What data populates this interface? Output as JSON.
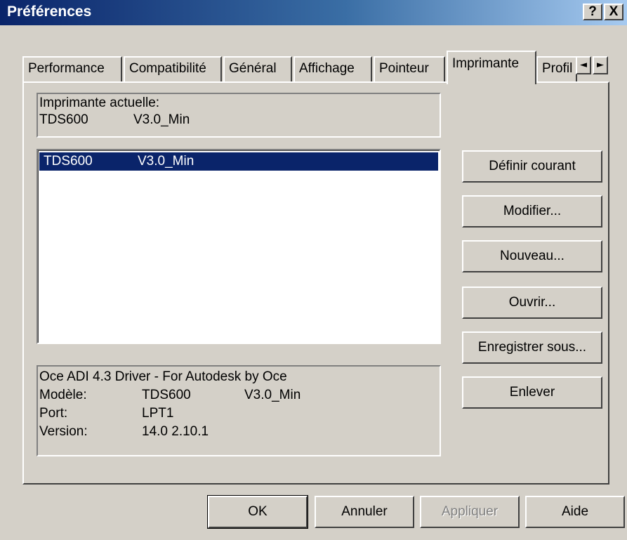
{
  "window": {
    "title": "Préférences",
    "help_symbol": "?",
    "close_symbol": "X"
  },
  "tabs": [
    {
      "label": "Performance"
    },
    {
      "label": "Compatibilité"
    },
    {
      "label": "Général"
    },
    {
      "label": "Affichage"
    },
    {
      "label": "Pointeur"
    },
    {
      "label": "Imprimante",
      "active": true
    },
    {
      "label": "Profil"
    }
  ],
  "tab_scroll": {
    "left": "◄",
    "right": "►"
  },
  "current_printer": {
    "heading": "Imprimante actuelle:",
    "name": "TDS600",
    "model": "V3.0_Min"
  },
  "printer_list": [
    {
      "name": "TDS600",
      "model": "V3.0_Min",
      "selected": true
    }
  ],
  "details": {
    "driver": "Oce ADI 4.3 Driver - For Autodesk by Oce",
    "model_label": "Modèle:",
    "model_name": "TDS600",
    "model_version": "V3.0_Min",
    "port_label": "Port:",
    "port_value": "LPT1",
    "version_label": "Version:",
    "version_value": "14.0 2.10.1"
  },
  "side_buttons": {
    "set_current": "Définir courant",
    "modify": "Modifier...",
    "new": "Nouveau...",
    "open": "Ouvrir...",
    "save_as": "Enregistrer sous...",
    "remove": "Enlever"
  },
  "bottom_buttons": {
    "ok": "OK",
    "cancel": "Annuler",
    "apply": "Appliquer",
    "help": "Aide"
  },
  "colors": {
    "face": "#d4d0c8",
    "title_start": "#0a246a",
    "title_end": "#a6caf0",
    "selection": "#0a246a"
  }
}
